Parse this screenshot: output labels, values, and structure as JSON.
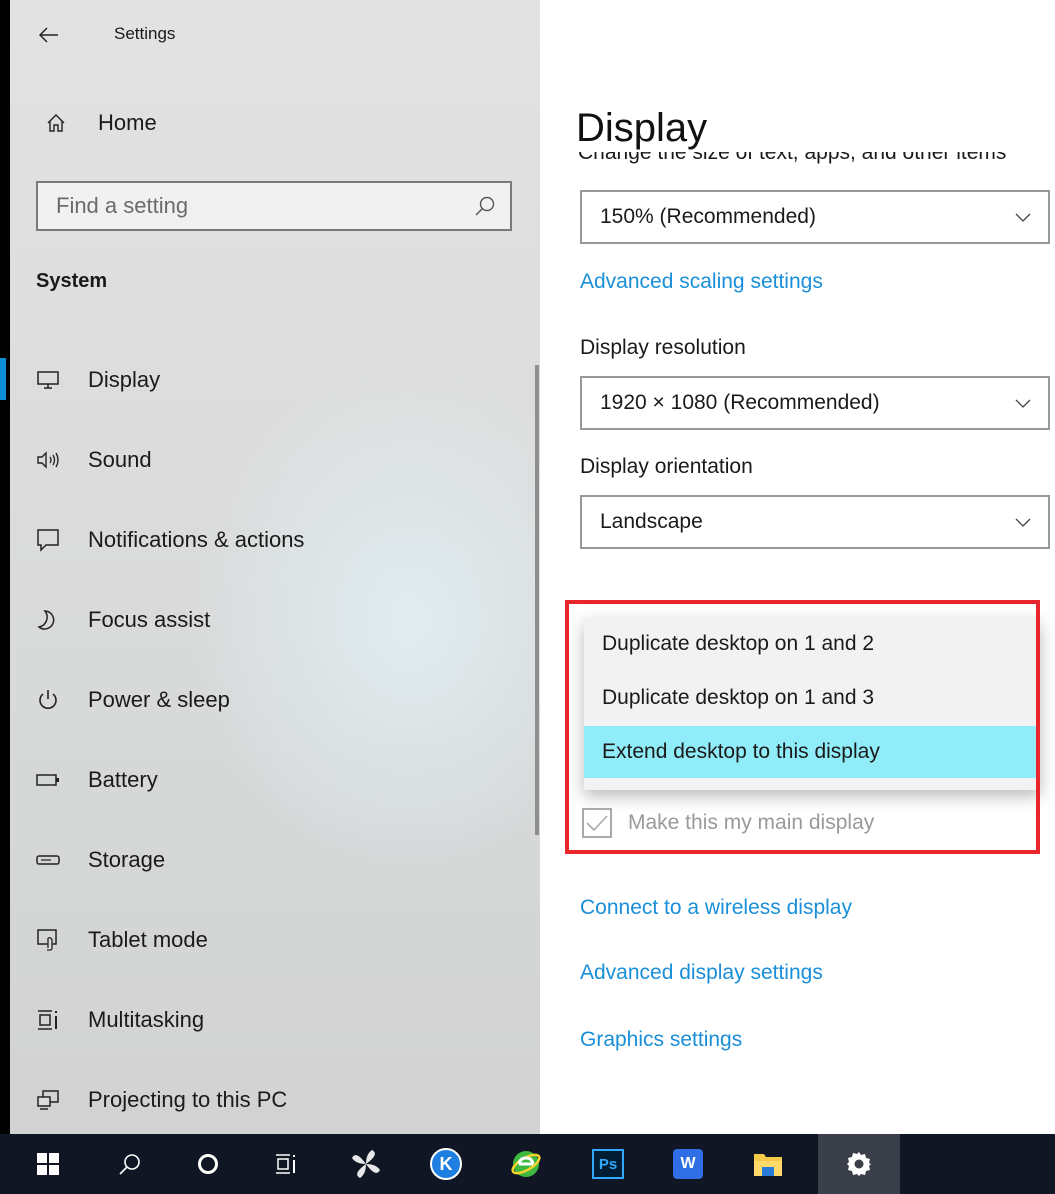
{
  "window": {
    "title": "Settings"
  },
  "sidebar": {
    "home_label": "Home",
    "search_placeholder": "Find a setting",
    "section_title": "System",
    "items": [
      {
        "label": "Display",
        "icon": "monitor-icon",
        "active": true
      },
      {
        "label": "Sound",
        "icon": "speaker-icon",
        "active": false
      },
      {
        "label": "Notifications & actions",
        "icon": "notifications-icon",
        "active": false
      },
      {
        "label": "Focus assist",
        "icon": "moon-icon",
        "active": false
      },
      {
        "label": "Power & sleep",
        "icon": "power-icon",
        "active": false
      },
      {
        "label": "Battery",
        "icon": "battery-icon",
        "active": false
      },
      {
        "label": "Storage",
        "icon": "storage-icon",
        "active": false
      },
      {
        "label": "Tablet mode",
        "icon": "tablet-mode-icon",
        "active": false
      },
      {
        "label": "Multitasking",
        "icon": "multitasking-icon",
        "active": false
      },
      {
        "label": "Projecting to this PC",
        "icon": "projecting-icon",
        "active": false
      }
    ]
  },
  "main": {
    "title": "Display",
    "clipped_text": "Change the size of text, apps, and other items",
    "scale_select": "150% (Recommended)",
    "advanced_scaling_link": "Advanced scaling settings",
    "resolution_label": "Display resolution",
    "resolution_select": "1920 × 1080 (Recommended)",
    "orientation_label": "Display orientation",
    "orientation_select": "Landscape",
    "multiple_displays_dropdown": {
      "options": [
        "Duplicate desktop on 1 and 2",
        "Duplicate desktop on 1 and 3",
        "Extend desktop to this display"
      ],
      "selected_index": 2
    },
    "main_display_checkbox": {
      "label": "Make this my main display",
      "checked": true,
      "disabled": true
    },
    "links": {
      "wireless": "Connect to a wireless display",
      "advanced_display": "Advanced display settings",
      "graphics": "Graphics settings"
    }
  },
  "taskbar": {
    "apps": [
      "windows-start-icon",
      "search-icon",
      "cortana-icon",
      "task-view-icon",
      "pinwheel-app-icon",
      "k-app-icon",
      "ie-browser-icon",
      "photoshop-icon",
      "wps-office-icon",
      "file-explorer-icon",
      "settings-gear-icon"
    ],
    "photoshop_label": "Ps",
    "k_label": "K",
    "wps_label": "W"
  },
  "colors": {
    "accent_link": "#1a8fd9",
    "selected_option": "#90ecf9",
    "highlight_border": "#e8262b",
    "nav_active_bar": "#0a8fd6",
    "taskbar_bg": "#101623"
  }
}
